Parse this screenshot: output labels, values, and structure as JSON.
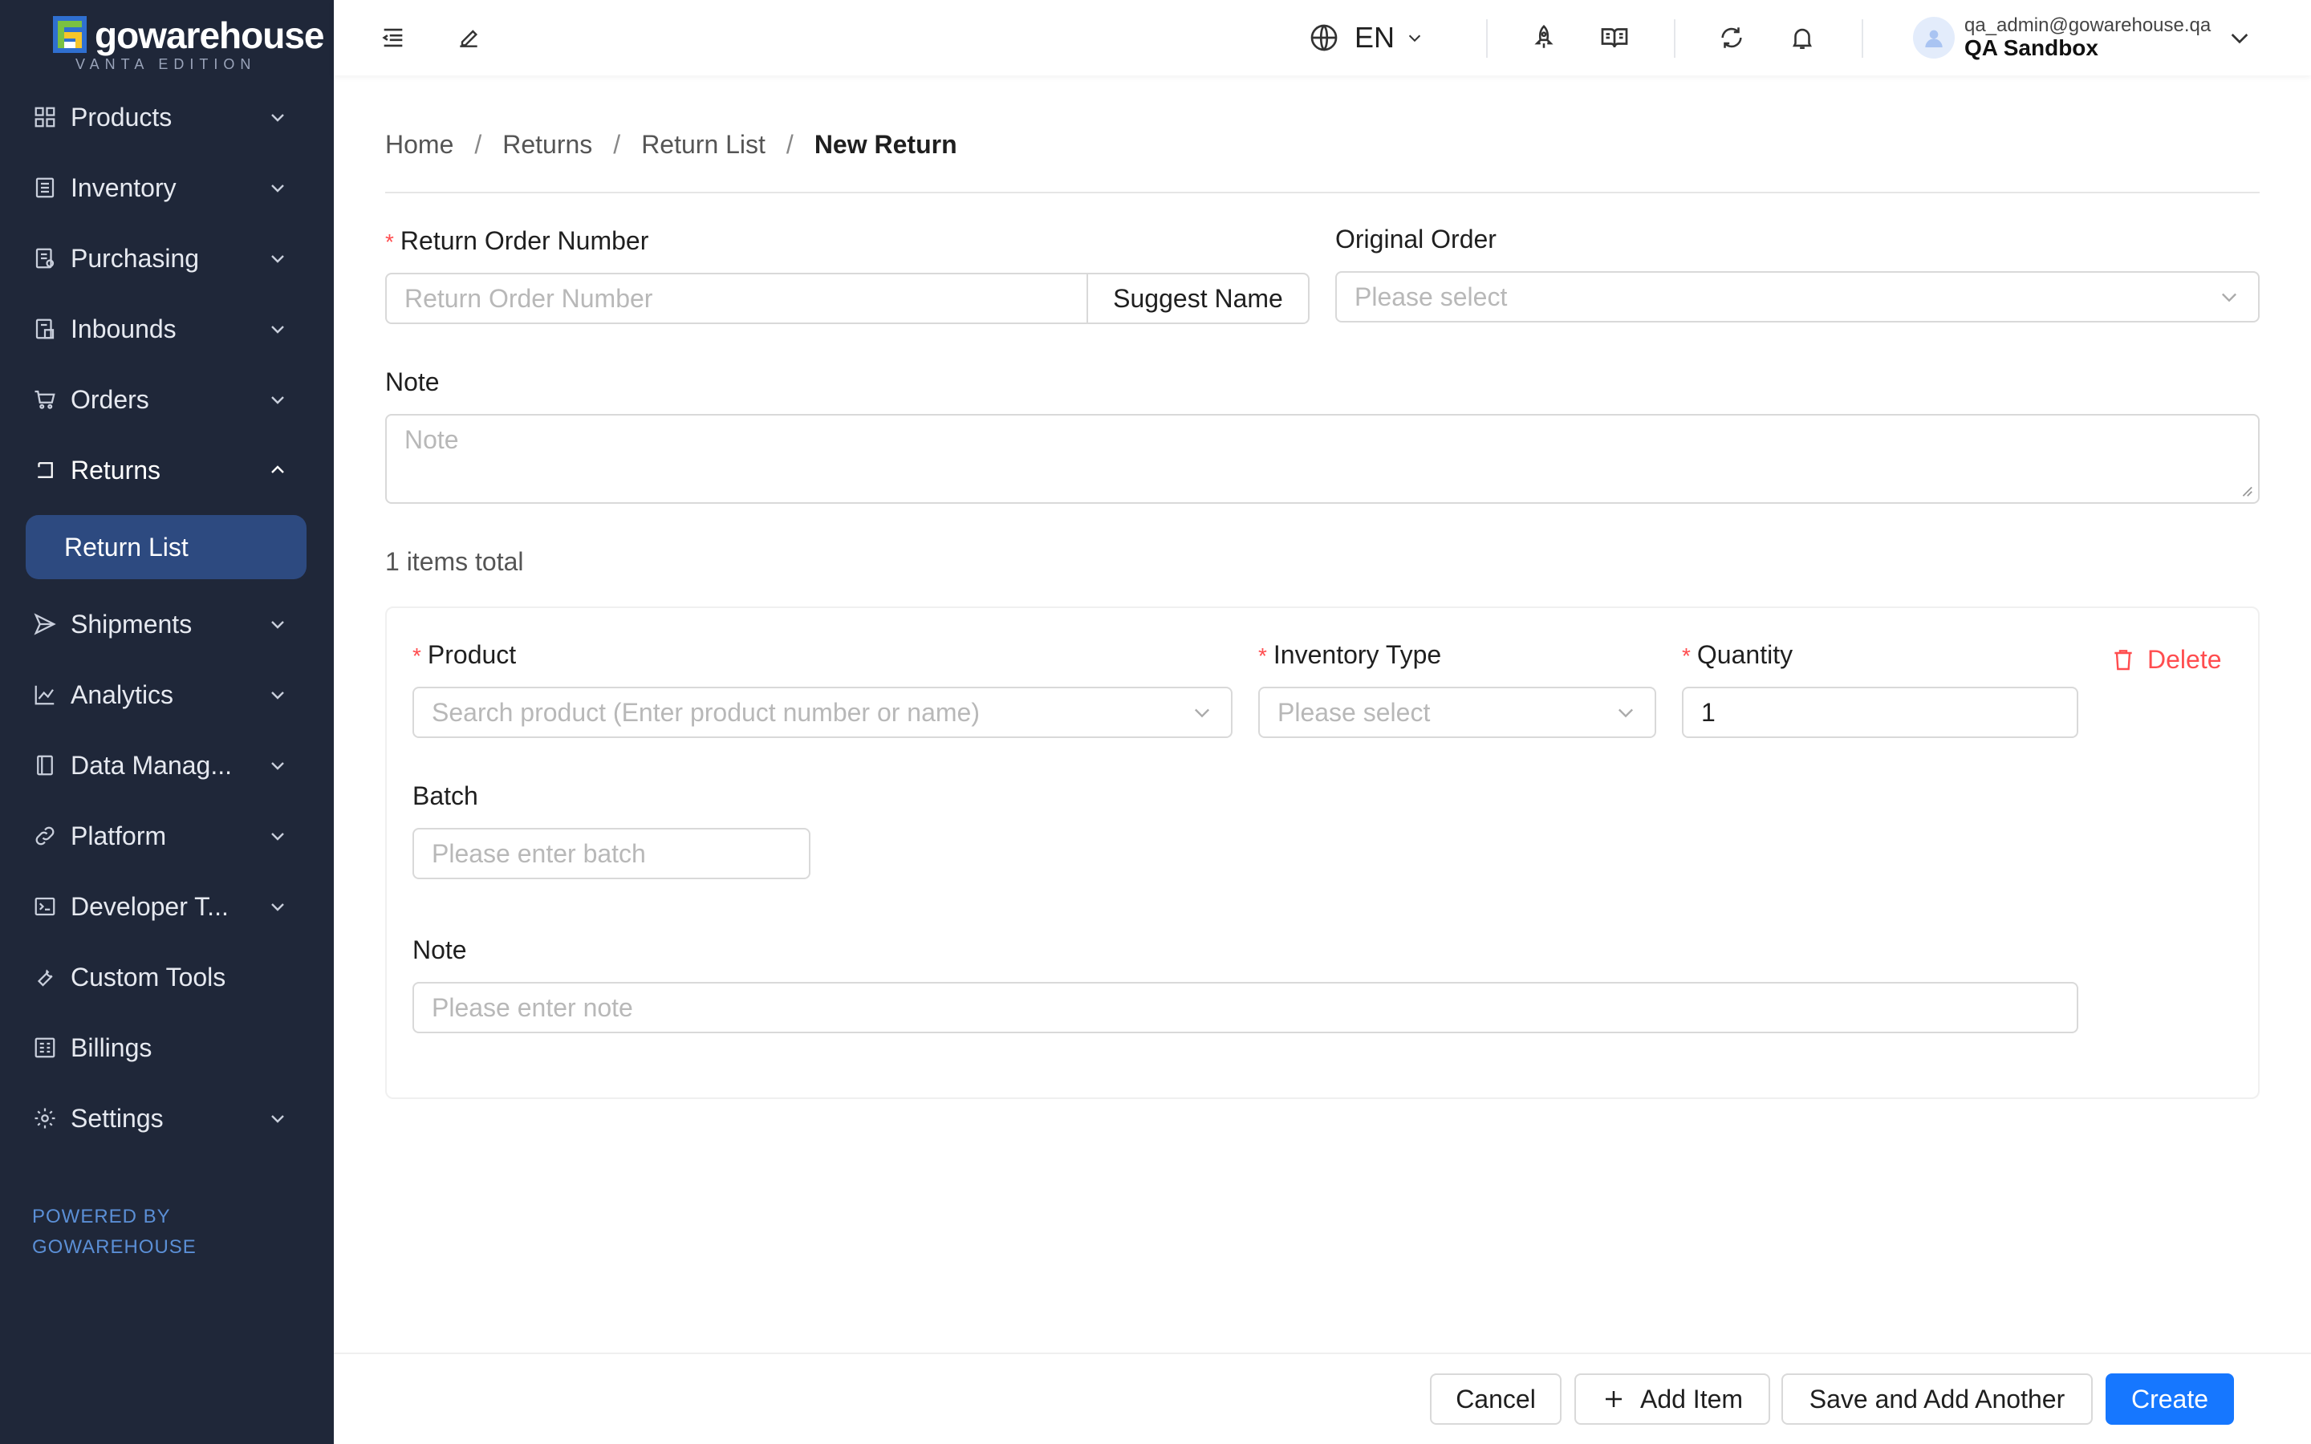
{
  "brand": {
    "name": "gowarehouse",
    "edition": "VANTA EDITION",
    "colors": {
      "green": "#7ac143",
      "yellow": "#f7c52a",
      "blue": "#2f6fd0"
    }
  },
  "sidebar": {
    "items": [
      {
        "label": "Products",
        "icon": "grid-icon"
      },
      {
        "label": "Inventory",
        "icon": "inventory-icon"
      },
      {
        "label": "Purchasing",
        "icon": "purchasing-icon"
      },
      {
        "label": "Inbounds",
        "icon": "inbounds-icon"
      },
      {
        "label": "Orders",
        "icon": "cart-icon"
      },
      {
        "label": "Returns",
        "icon": "return-icon",
        "expanded": true
      },
      {
        "label": "Shipments",
        "icon": "send-icon"
      },
      {
        "label": "Analytics",
        "icon": "chart-icon"
      },
      {
        "label": "Data Manag...",
        "icon": "book-icon"
      },
      {
        "label": "Platform",
        "icon": "link-icon"
      },
      {
        "label": "Developer T...",
        "icon": "terminal-icon"
      },
      {
        "label": "Custom Tools",
        "icon": "wrench-icon"
      },
      {
        "label": "Billings",
        "icon": "billing-icon"
      },
      {
        "label": "Settings",
        "icon": "gear-icon"
      }
    ],
    "active_sub": "Return List",
    "powered_line1": "POWERED BY",
    "powered_line2": "GOWAREHOUSE"
  },
  "header": {
    "language": "EN",
    "user_email": "qa_admin@gowarehouse.qa",
    "user_org": "QA Sandbox"
  },
  "breadcrumb": [
    "Home",
    "Returns",
    "Return List",
    "New Return"
  ],
  "form": {
    "return_order_number": {
      "label": "Return Order Number",
      "placeholder": "Return Order Number",
      "addon": "Suggest Name"
    },
    "original_order": {
      "label": "Original Order",
      "placeholder": "Please select"
    },
    "note": {
      "label": "Note",
      "placeholder": "Note"
    }
  },
  "items_total": "1 items total",
  "item": {
    "product": {
      "label": "Product",
      "placeholder": "Search product (Enter product number or name)"
    },
    "inventory_type": {
      "label": "Inventory Type",
      "placeholder": "Please select"
    },
    "quantity": {
      "label": "Quantity",
      "value": "1"
    },
    "delete": "Delete",
    "batch": {
      "label": "Batch",
      "placeholder": "Please enter batch"
    },
    "note": {
      "label": "Note",
      "placeholder": "Please enter note"
    }
  },
  "footer": {
    "cancel": "Cancel",
    "add_item": "Add Item",
    "save_add_another": "Save and Add Another",
    "create": "Create"
  }
}
